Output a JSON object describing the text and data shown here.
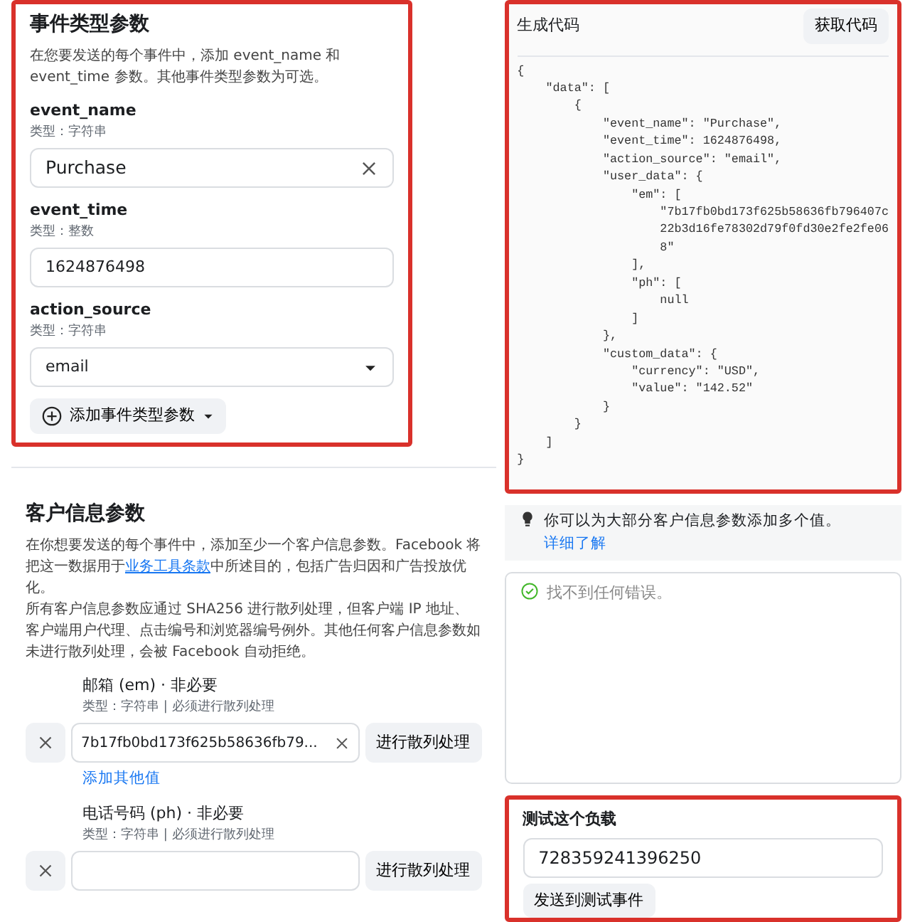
{
  "event_params": {
    "highlighted": true,
    "title": "事件类型参数",
    "description": "在您要发送的每个事件中，添加 event_name 和 event_time 参数。其他事件类型参数为可选。",
    "fields": [
      {
        "kind": "text-clear",
        "name": "event_name",
        "type": "类型：字符串",
        "value": "Purchase"
      },
      {
        "kind": "text",
        "name": "event_time",
        "type": "类型：整数",
        "value": "1624876498"
      },
      {
        "kind": "select",
        "name": "action_source",
        "type": "类型：字符串",
        "value": "email"
      }
    ],
    "add_button": "添加事件类型参数"
  },
  "customer_params": {
    "highlighted": false,
    "title": "客户信息参数",
    "desc_before": "在你想要发送的每个事件中，添加至少一个客户信息参数。Facebook 将把这一数据用于",
    "desc_link": "业务工具条款",
    "desc_after": "中所述目的，包括广告归因和广告投放优化。",
    "description_2": "所有客户信息参数应通过 SHA256 进行散列处理，但客户端 IP 地址、客户端用户代理、点击编号和浏览器编号例外。其他任何客户信息参数如未进行散列处理，会被 Facebook 自动拒绝。",
    "fields": [
      {
        "label": "邮箱 (em) · 非必要",
        "type": "类型：字符串 | 必须进行散列处理",
        "value": "7b17fb0bd173f625b58636fb79...",
        "hash_button": "进行散列处理",
        "add_more": "添加其他值"
      },
      {
        "label": "电话号码 (ph) · 非必要",
        "type": "类型：字符串 | 必须进行散列处理",
        "hash_button": "进行散列处理"
      }
    ]
  },
  "code_panel": {
    "highlighted": true,
    "title": "生成代码",
    "button": "获取代码",
    "code": "{\n    \"data\": [\n        {\n            \"event_name\": \"Purchase\",\n            \"event_time\": 1624876498,\n            \"action_source\": \"email\",\n            \"user_data\": {\n                \"em\": [\n                    \"7b17fb0bd173f625b58636fb796407c\n                    22b3d16fe78302d79f0fd30e2fe2fe06\n                    8\"\n                ],\n                \"ph\": [\n                    null\n                ]\n            },\n            \"custom_data\": {\n                \"currency\": \"USD\",\n                \"value\": \"142.52\"\n            }\n        }\n    ]\n}"
  },
  "tip": {
    "text": "你可以为大部分客户信息参数添加多个值。",
    "link": "详细了解"
  },
  "validation": {
    "message": "找不到任何错误。"
  },
  "test_payload": {
    "highlighted": true,
    "title": "测试这个负载",
    "value": "728359241396250",
    "button": "发送到测试事件"
  }
}
